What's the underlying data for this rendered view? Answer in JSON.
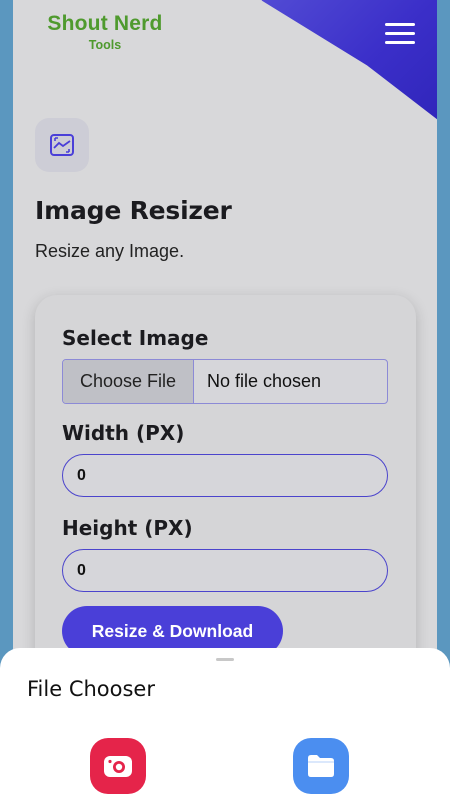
{
  "header": {
    "logo_title": "Shout Nerd",
    "logo_subtitle": "Tools",
    "menu_icon": "hamburger-menu-icon"
  },
  "tool": {
    "icon": "image-resize-icon",
    "title": "Image Resizer",
    "description": "Resize any Image."
  },
  "form": {
    "select_label": "Select Image",
    "file_button": "Choose File",
    "file_status": "No file chosen",
    "width_label": "Width (PX)",
    "width_value": "0",
    "height_label": "Height (PX)",
    "height_value": "0",
    "submit_label": "Resize & Download"
  },
  "file_chooser": {
    "title": "File Chooser",
    "apps": [
      {
        "icon": "camera-app-icon"
      },
      {
        "icon": "files-app-icon"
      }
    ]
  },
  "colors": {
    "brand_green": "#4f9a2e",
    "accent_purple": "#4a3fd8",
    "camera_red": "#e5244a",
    "files_blue": "#4b8ef0"
  }
}
